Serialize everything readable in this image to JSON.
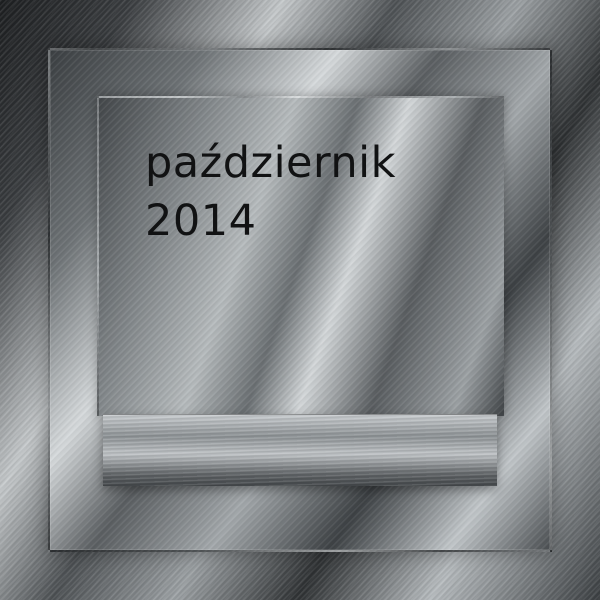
{
  "label": {
    "month": "październik",
    "year": "2014"
  },
  "colors": {
    "text": "#111213",
    "metal_dark": "#2a2c2e",
    "metal_light": "#d4d8da"
  }
}
